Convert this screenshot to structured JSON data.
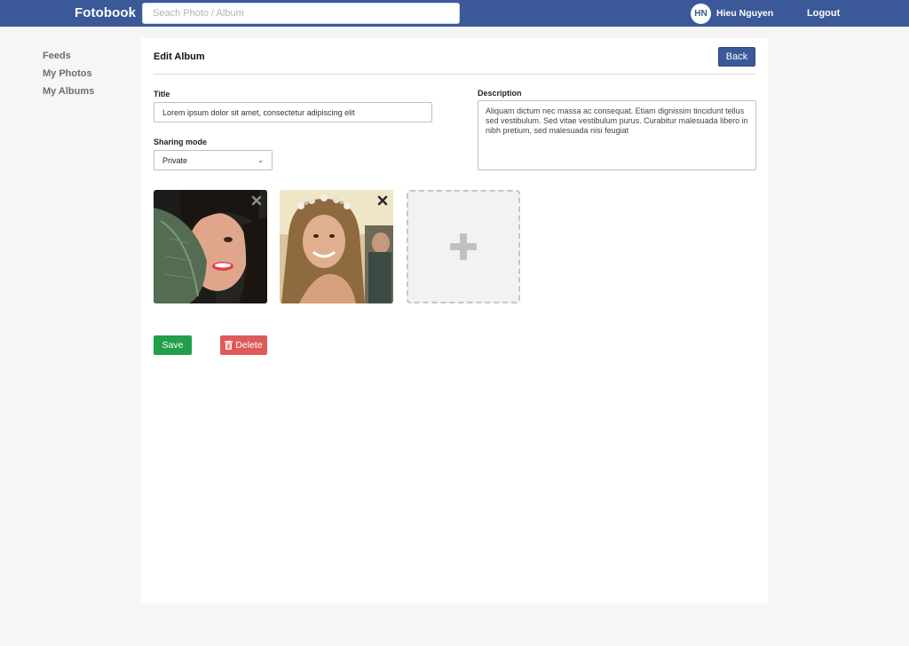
{
  "header": {
    "brand": "Fotobook",
    "search_placeholder": "Seach Photo / Album",
    "avatar_initials": "HN",
    "user_name": "Hieu Nguyen",
    "logout_label": "Logout",
    "color": "#3b5998"
  },
  "sidebar": {
    "items": [
      {
        "label": "Feeds"
      },
      {
        "label": "My Photos"
      },
      {
        "label": "My Albums"
      }
    ]
  },
  "main": {
    "heading": "Edit Album",
    "back_label": "Back",
    "title_label": "Title",
    "title_value": "Lorem ipsum dolor sit amet, consectetur adipiscing elit",
    "description_label": "Description",
    "description_value": "Aliquam dictum nec massa ac consequat. Etiam dignissim tincidunt tellus sed vestibulum. Sed vitae vestibulum purus. Curabitur malesuada libero in nibh pretium, sed malesuada nisi feugiat",
    "sharing_label": "Sharing mode",
    "sharing_value": "Private",
    "photos": [
      {
        "icon": "remove-icon"
      },
      {
        "icon": "remove-icon"
      }
    ],
    "add_icon": "plus-icon",
    "save_label": "Save",
    "delete_label": "Delete",
    "colors": {
      "save": "#21a04b",
      "delete": "#e05a5a"
    }
  }
}
